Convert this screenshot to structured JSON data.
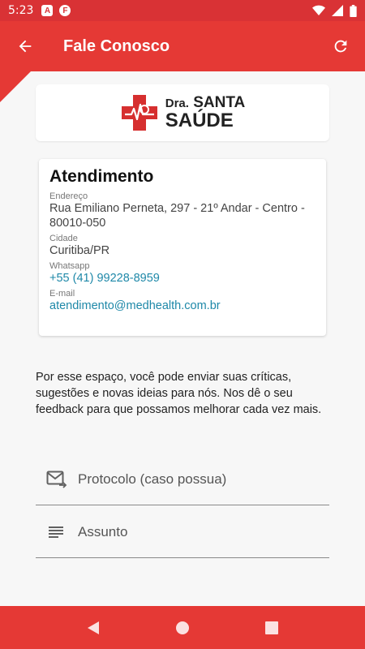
{
  "status_bar": {
    "time": "5:23",
    "notif_a": "A",
    "notif_b": "F"
  },
  "app_bar": {
    "title": "Fale Conosco"
  },
  "logo": {
    "line1_pre": "Dra.",
    "line1": "SANTA",
    "line2": "SAÚDE"
  },
  "contact": {
    "heading": "Atendimento",
    "address_label": "Endereço",
    "address": "Rua Emiliano Perneta, 297 - 21º Andar - Centro - 80010-050",
    "city_label": "Cidade",
    "city": "Curitiba/PR",
    "whatsapp_label": "Whatsapp",
    "whatsapp": "+55 (41) 99228-8959",
    "email_label": "E-mail",
    "email": "atendimento@medhealth.com.br"
  },
  "description": "Por esse espaço, você pode enviar suas críticas, sugestões e novas ideias para nós. Nos dê o seu feedback para que possamos melhorar cada vez mais.",
  "form": {
    "protocol_placeholder": "Protocolo (caso possua)",
    "subject_placeholder": "Assunto"
  },
  "colors": {
    "primary": "#e53935",
    "status": "#d93235",
    "link": "#1e88a8"
  },
  "icons": [
    "back-arrow-icon",
    "refresh-icon",
    "mail-forward-icon",
    "subject-lines-icon",
    "nav-back-icon",
    "nav-home-icon",
    "nav-recents-icon",
    "wifi-icon",
    "signal-icon",
    "battery-icon"
  ]
}
